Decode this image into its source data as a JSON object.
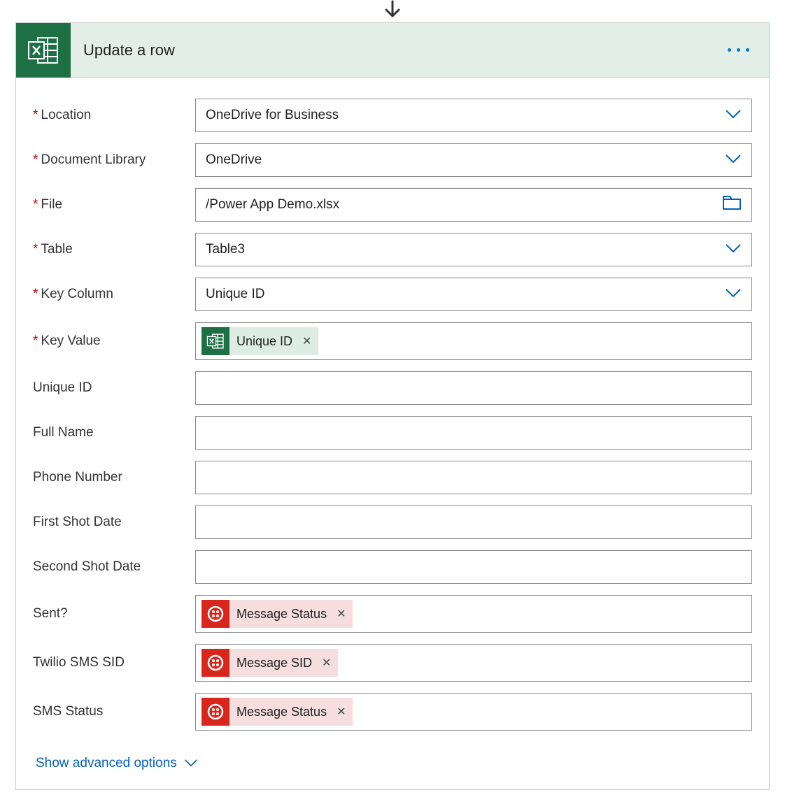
{
  "header": {
    "title": "Update a row"
  },
  "fields": {
    "location": {
      "label": "Location",
      "required": true,
      "value": "OneDrive for Business",
      "control": "dropdown"
    },
    "document_library": {
      "label": "Document Library",
      "required": true,
      "value": "OneDrive",
      "control": "dropdown"
    },
    "file": {
      "label": "File",
      "required": true,
      "value": "/Power App Demo.xlsx",
      "control": "file"
    },
    "table": {
      "label": "Table",
      "required": true,
      "value": "Table3",
      "control": "dropdown"
    },
    "key_column": {
      "label": "Key Column",
      "required": true,
      "value": "Unique ID",
      "control": "dropdown"
    },
    "key_value": {
      "label": "Key Value",
      "required": true,
      "token": {
        "source": "excel",
        "text": "Unique ID"
      }
    },
    "unique_id": {
      "label": "Unique ID",
      "required": false,
      "value": ""
    },
    "full_name": {
      "label": "Full Name",
      "required": false,
      "value": ""
    },
    "phone_number": {
      "label": "Phone Number",
      "required": false,
      "value": ""
    },
    "first_shot_date": {
      "label": "First Shot Date",
      "required": false,
      "value": ""
    },
    "second_shot_date": {
      "label": "Second Shot Date",
      "required": false,
      "value": ""
    },
    "sent": {
      "label": "Sent?",
      "required": false,
      "token": {
        "source": "twilio",
        "text": "Message Status"
      }
    },
    "twilio_sms_sid": {
      "label": "Twilio SMS SID",
      "required": false,
      "token": {
        "source": "twilio",
        "text": "Message SID"
      }
    },
    "sms_status": {
      "label": "SMS Status",
      "required": false,
      "token": {
        "source": "twilio",
        "text": "Message Status"
      }
    }
  },
  "advanced_link": "Show advanced options"
}
